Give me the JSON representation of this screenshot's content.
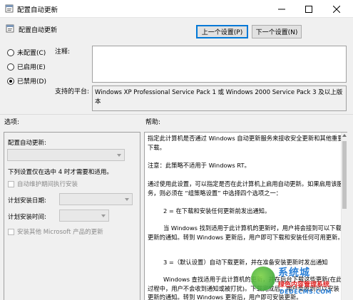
{
  "window": {
    "title": "配置自动更新",
    "controls": {
      "minimize": "—",
      "maximize": "☐",
      "close": "✕"
    }
  },
  "policy": {
    "name": "配置自动更新",
    "prev_button": "上一个设置(P)",
    "next_button": "下一个设置(N)"
  },
  "state_options": [
    {
      "label": "未配置(C)",
      "checked": false
    },
    {
      "label": "已启用(E)",
      "checked": false
    },
    {
      "label": "已禁用(D)",
      "checked": true
    }
  ],
  "comment": {
    "label": "注释:",
    "value": ""
  },
  "supported": {
    "label": "支持的平台:",
    "value": "Windows XP Professional Service Pack 1 或 Windows 2000 Service Pack 3 及以上版本"
  },
  "options_section": {
    "label": "选项:",
    "heading": "配置自动更新:",
    "note": "下列设置仅在选中 4 时才需要和适用。",
    "maintenance_checkbox": "自动维护期间执行安装",
    "install_day_label": "计划安装日期:",
    "install_time_label": "计划安装时间:",
    "other_products_checkbox": "安装其他 Microsoft 产品的更新"
  },
  "help_section": {
    "label": "帮助:",
    "paragraphs": [
      "指定此计算机是否通过 Windows 自动更新服务来接收安全更新和其他重要下载。",
      "注意：此策略不适用于 Windows RT。",
      "通过使用此设置，可以指定是否在此计算机上启用自动更新。如果启用该服务，则必须在 “组策略设置” 中选择四个选项之一：",
      "2 = 在下载和安装任何更新前发出通知。",
      "当 Windows 找到适用于此计算机的更新时，用户将会接到可以下载更新的通知。转到 Windows 更新后，用户即可下载和安装任何可用更新。",
      "3 =（默认设置）自动下载更新，并在准备安装更新时发出通知",
      "Windows 查找适用于此计算机的更新，并在后台下载这些更新(在此过程中，用户不会收到通知或被打扰)。下载完成后，用户会收到可以安装更新的通知。转到 Windows 更新后，用户即可安装更新。"
    ]
  },
  "watermark": {
    "logo_text": "系统城",
    "subtitle": "绿色内容管理系统",
    "url": "DEDECMS.COM"
  },
  "colors": {
    "background": "#f0f0f0",
    "accent_border": "#0078d7"
  }
}
